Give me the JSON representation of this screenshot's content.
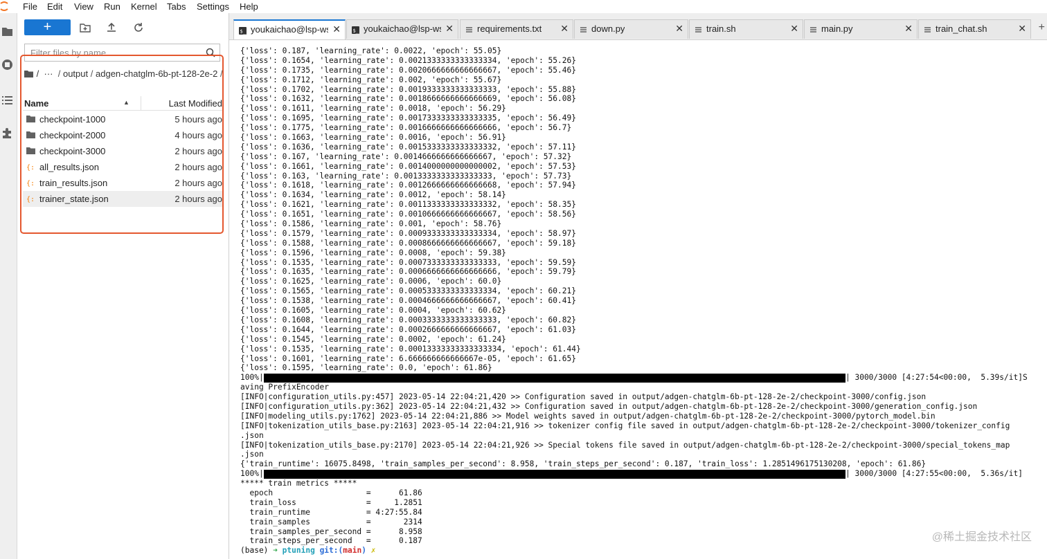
{
  "menubar": {
    "items": [
      "File",
      "Edit",
      "View",
      "Run",
      "Kernel",
      "Tabs",
      "Settings",
      "Help"
    ]
  },
  "file_browser": {
    "new_button_label": "+",
    "filter_placeholder": "Filter files by name",
    "breadcrumbs": {
      "root": "/",
      "ellipsis": "···",
      "segments": [
        "output",
        "adgen-chatglm-6b-pt-128-2e-2"
      ],
      "separator": "/"
    },
    "columns": {
      "name": "Name",
      "last_modified": "Last Modified"
    },
    "files": [
      {
        "name": "checkpoint-1000",
        "modified": "5 hours ago",
        "type": "folder"
      },
      {
        "name": "checkpoint-2000",
        "modified": "4 hours ago",
        "type": "folder"
      },
      {
        "name": "checkpoint-3000",
        "modified": "2 hours ago",
        "type": "folder"
      },
      {
        "name": "all_results.json",
        "modified": "2 hours ago",
        "type": "json"
      },
      {
        "name": "train_results.json",
        "modified": "2 hours ago",
        "type": "json"
      },
      {
        "name": "trainer_state.json",
        "modified": "2 hours ago",
        "type": "json",
        "selected": true
      }
    ]
  },
  "tabs": [
    {
      "label": "youkaichao@lsp-ws:/",
      "icon": "terminal-icon",
      "active": true
    },
    {
      "label": "youkaichao@lsp-ws:/",
      "icon": "terminal-icon",
      "active": false
    },
    {
      "label": "requirements.txt",
      "icon": "text-file-icon",
      "active": false
    },
    {
      "label": "down.py",
      "icon": "text-file-icon",
      "active": false
    },
    {
      "label": "train.sh",
      "icon": "text-file-icon",
      "active": false
    },
    {
      "label": "main.py",
      "icon": "text-file-icon",
      "active": false
    },
    {
      "label": "train_chat.sh",
      "icon": "text-file-icon",
      "active": false
    }
  ],
  "tab_close_glyph": "✕",
  "tab_add_glyph": "+",
  "terminal": {
    "lines": [
      "{'loss': 0.187, 'learning_rate': 0.0022, 'epoch': 55.05}",
      "{'loss': 0.1654, 'learning_rate': 0.0021333333333333334, 'epoch': 55.26}",
      "{'loss': 0.1735, 'learning_rate': 0.0020666666666666667, 'epoch': 55.46}",
      "{'loss': 0.1712, 'learning_rate': 0.002, 'epoch': 55.67}",
      "{'loss': 0.1702, 'learning_rate': 0.0019333333333333333, 'epoch': 55.88}",
      "{'loss': 0.1632, 'learning_rate': 0.0018666666666666669, 'epoch': 56.08}",
      "{'loss': 0.1611, 'learning_rate': 0.0018, 'epoch': 56.29}",
      "{'loss': 0.1695, 'learning_rate': 0.0017333333333333335, 'epoch': 56.49}",
      "{'loss': 0.1775, 'learning_rate': 0.0016666666666666666, 'epoch': 56.7}",
      "{'loss': 0.1663, 'learning_rate': 0.0016, 'epoch': 56.91}",
      "{'loss': 0.1636, 'learning_rate': 0.0015333333333333332, 'epoch': 57.11}",
      "{'loss': 0.167, 'learning_rate': 0.0014666666666666667, 'epoch': 57.32}",
      "{'loss': 0.1661, 'learning_rate': 0.0014000000000000002, 'epoch': 57.53}",
      "{'loss': 0.163, 'learning_rate': 0.0013333333333333333, 'epoch': 57.73}",
      "{'loss': 0.1618, 'learning_rate': 0.0012666666666666668, 'epoch': 57.94}",
      "{'loss': 0.1634, 'learning_rate': 0.0012, 'epoch': 58.14}",
      "{'loss': 0.1621, 'learning_rate': 0.0011333333333333332, 'epoch': 58.35}",
      "{'loss': 0.1651, 'learning_rate': 0.0010666666666666667, 'epoch': 58.56}",
      "{'loss': 0.1586, 'learning_rate': 0.001, 'epoch': 58.76}",
      "{'loss': 0.1579, 'learning_rate': 0.0009333333333333334, 'epoch': 58.97}",
      "{'loss': 0.1588, 'learning_rate': 0.0008666666666666667, 'epoch': 59.18}",
      "{'loss': 0.1596, 'learning_rate': 0.0008, 'epoch': 59.38}",
      "{'loss': 0.1535, 'learning_rate': 0.0007333333333333333, 'epoch': 59.59}",
      "{'loss': 0.1635, 'learning_rate': 0.0006666666666666666, 'epoch': 59.79}",
      "{'loss': 0.1625, 'learning_rate': 0.0006, 'epoch': 60.0}",
      "{'loss': 0.1565, 'learning_rate': 0.0005333333333333334, 'epoch': 60.21}",
      "{'loss': 0.1538, 'learning_rate': 0.0004666666666666667, 'epoch': 60.41}",
      "{'loss': 0.1605, 'learning_rate': 0.0004, 'epoch': 60.62}",
      "{'loss': 0.1608, 'learning_rate': 0.0003333333333333333, 'epoch': 60.82}",
      "{'loss': 0.1644, 'learning_rate': 0.0002666666666666667, 'epoch': 61.03}",
      "{'loss': 0.1545, 'learning_rate': 0.0002, 'epoch': 61.24}",
      "{'loss': 0.1535, 'learning_rate': 0.00013333333333333334, 'epoch': 61.44}",
      "{'loss': 0.1601, 'learning_rate': 6.666666666666667e-05, 'epoch': 61.65}",
      "{'loss': 0.1595, 'learning_rate': 0.0, 'epoch': 61.86}"
    ],
    "progress1": {
      "prefix": "100%|",
      "status": "| 3000/3000 [4:27:54<00:00,  5.39s/it]S",
      "fraction": 1.0
    },
    "lines_after_progress1": [
      "aving PrefixEncoder",
      "[INFO|configuration_utils.py:457] 2023-05-14 22:04:21,420 >> Configuration saved in output/adgen-chatglm-6b-pt-128-2e-2/checkpoint-3000/config.json",
      "[INFO|configuration_utils.py:362] 2023-05-14 22:04:21,432 >> Configuration saved in output/adgen-chatglm-6b-pt-128-2e-2/checkpoint-3000/generation_config.json",
      "[INFO|modeling_utils.py:1762] 2023-05-14 22:04:21,886 >> Model weights saved in output/adgen-chatglm-6b-pt-128-2e-2/checkpoint-3000/pytorch_model.bin",
      "[INFO|tokenization_utils_base.py:2163] 2023-05-14 22:04:21,916 >> tokenizer config file saved in output/adgen-chatglm-6b-pt-128-2e-2/checkpoint-3000/tokenizer_config",
      ".json",
      "[INFO|tokenization_utils_base.py:2170] 2023-05-14 22:04:21,926 >> Special tokens file saved in output/adgen-chatglm-6b-pt-128-2e-2/checkpoint-3000/special_tokens_map",
      ".json",
      "{'train_runtime': 16075.8498, 'train_samples_per_second': 8.958, 'train_steps_per_second': 0.187, 'train_loss': 1.2851496175130208, 'epoch': 61.86}"
    ],
    "progress2": {
      "prefix": "100%|",
      "status": "| 3000/3000 [4:27:55<00:00,  5.36s/it]",
      "fraction": 1.0
    },
    "metrics_header": "***** train metrics *****",
    "metrics": [
      "  epoch                    =      61.86",
      "  train_loss               =     1.2851",
      "  train_runtime            = 4:27:55.84",
      "  train_samples            =       2314",
      "  train_samples_per_second =      8.958",
      "  train_steps_per_second   =      0.187"
    ],
    "prompt": {
      "env": "(base) ",
      "arrow": "➜",
      "dir": "ptuning",
      "git": "git:(",
      "branch": "main",
      "git_close": ")",
      "dirty": "✗"
    }
  },
  "watermark": "@稀土掘金技术社区",
  "colors": {
    "accent": "#1976d2",
    "highlight": "#e4572e",
    "json_icon": "#f57c00",
    "folder_icon": "#616161"
  }
}
